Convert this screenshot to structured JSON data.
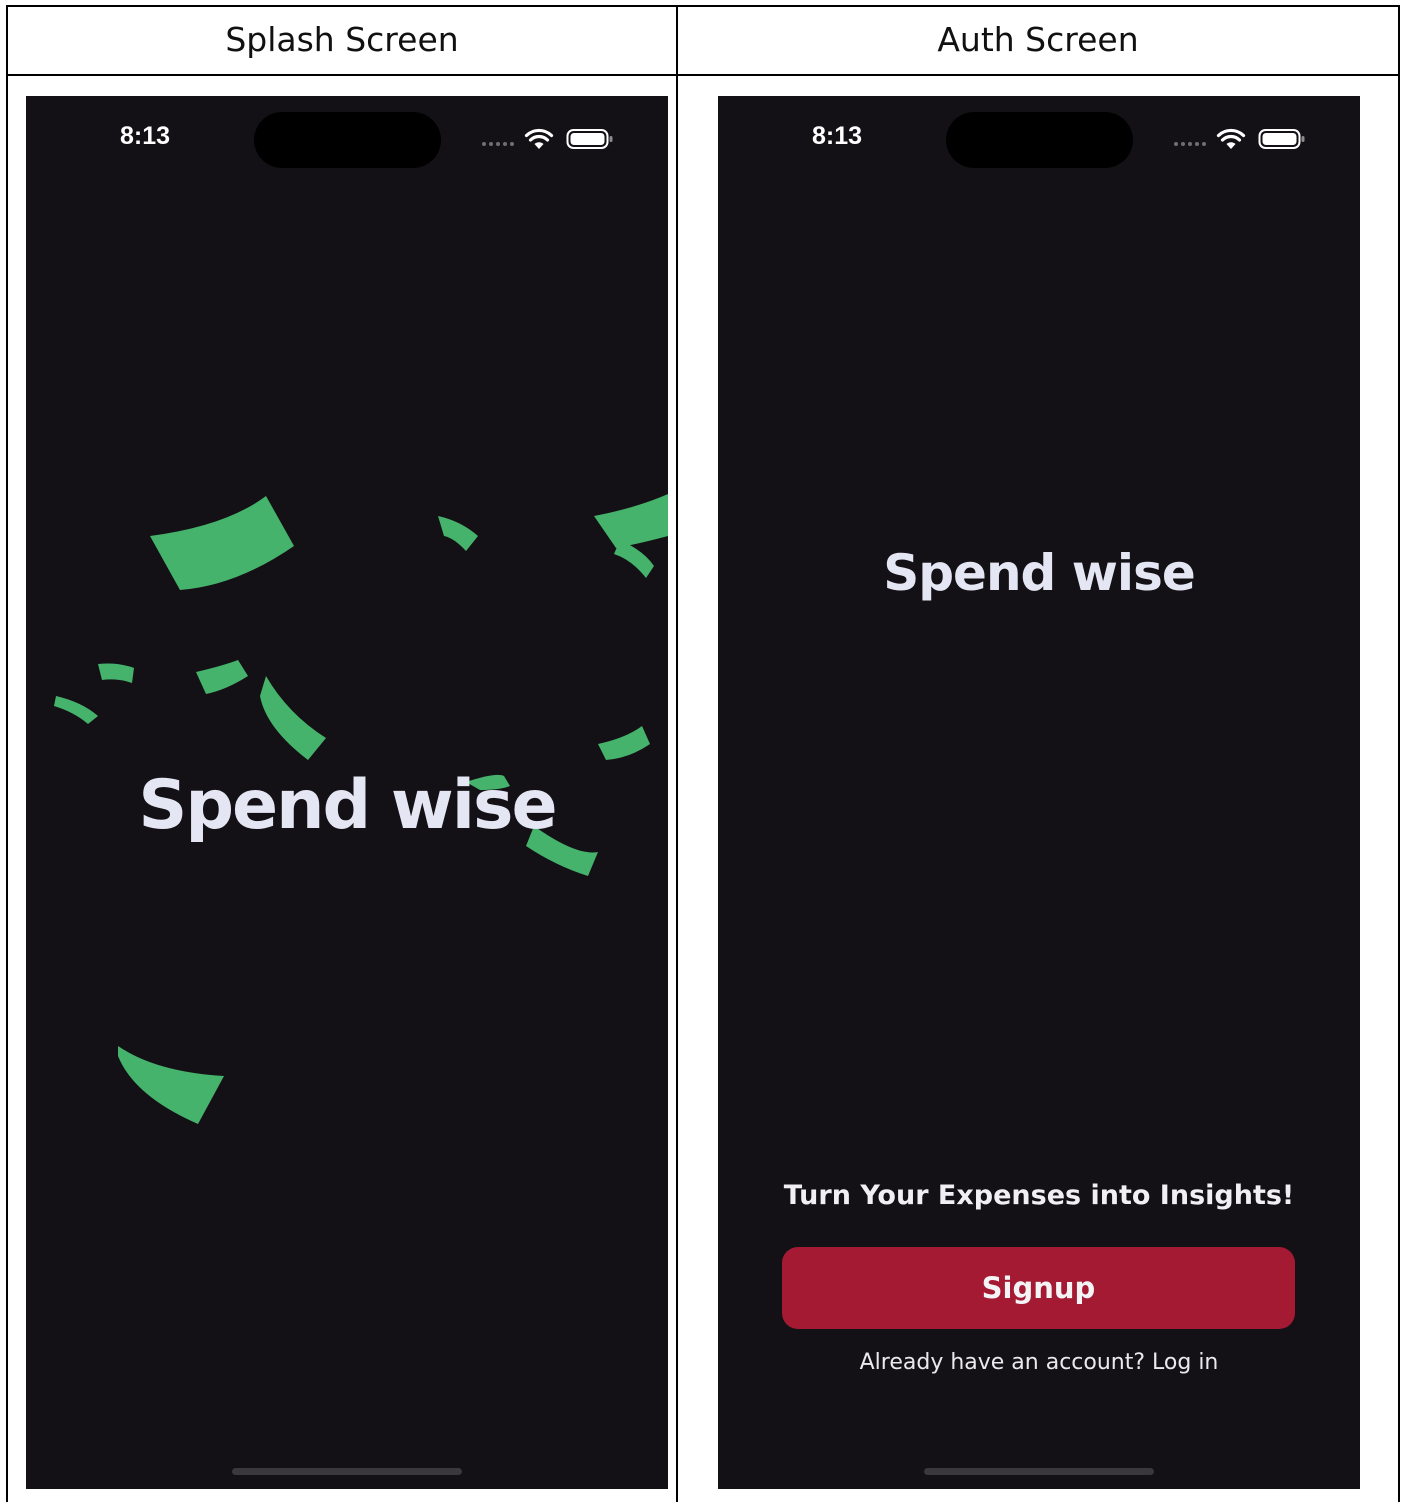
{
  "table": {
    "headers": [
      "Splash Screen",
      "Auth Screen"
    ]
  },
  "splash": {
    "status_time": "8:13",
    "title": "Spend wise"
  },
  "auth": {
    "status_time": "8:13",
    "title": "Spend wise",
    "tagline": "Turn Your Expenses into Insights!",
    "signup_label": "Signup",
    "login_prompt": "Already have an account? Log in"
  },
  "colors": {
    "background": "#141116",
    "title_text": "#e4e6f3",
    "signup_button": "#a41a33",
    "money_green": "#45b36b"
  },
  "icons": [
    "wifi-icon",
    "battery-icon",
    "cellular-signal-icon"
  ]
}
